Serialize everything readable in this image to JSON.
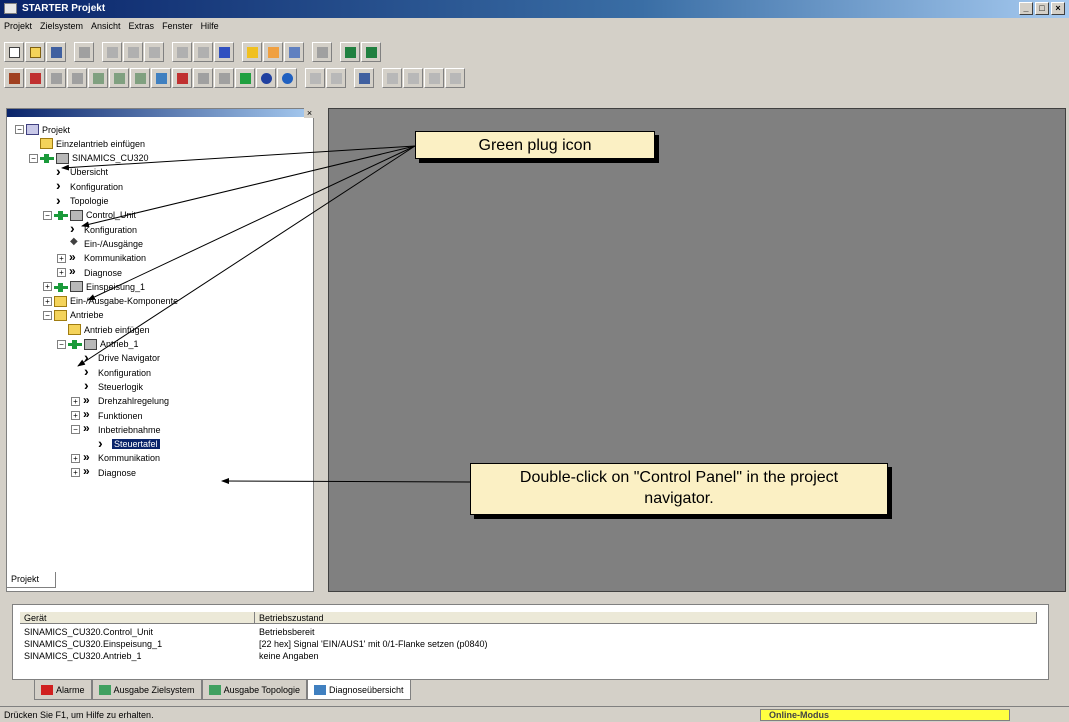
{
  "window": {
    "title": "STARTER  Projekt",
    "buttons": [
      "_",
      "□",
      "×"
    ]
  },
  "menu": [
    "Projekt",
    "Zielsystem",
    "Ansicht",
    "Extras",
    "Fenster",
    "Hilfe"
  ],
  "tree": {
    "tab": "Projekt",
    "nodes": [
      {
        "label": "Projekt",
        "indent": 0,
        "exp": "−",
        "icon": "proj"
      },
      {
        "label": "Einzelantrieb einfügen",
        "indent": 1,
        "icon": "folder"
      },
      {
        "label": "SINAMICS_CU320",
        "indent": 1,
        "exp": "−",
        "icon": "dev",
        "plug": true
      },
      {
        "label": "Übersicht",
        "indent": 2,
        "icon": "arrow"
      },
      {
        "label": "Konfiguration",
        "indent": 2,
        "icon": "arrow"
      },
      {
        "label": "Topologie",
        "indent": 2,
        "icon": "arrow"
      },
      {
        "label": "Control_Unit",
        "indent": 2,
        "exp": "−",
        "icon": "dev",
        "plug": true
      },
      {
        "label": "Konfiguration",
        "indent": 3,
        "icon": "arrow"
      },
      {
        "label": "Ein-/Ausgänge",
        "indent": 3,
        "icon": "io"
      },
      {
        "label": "Kommunikation",
        "indent": 3,
        "exp": "+",
        "icon": "darrow"
      },
      {
        "label": "Diagnose",
        "indent": 3,
        "exp": "+",
        "icon": "darrow"
      },
      {
        "label": "Einspeisung_1",
        "indent": 2,
        "exp": "+",
        "icon": "dev",
        "plug": true
      },
      {
        "label": "Ein-/Ausgabe-Komponente",
        "indent": 2,
        "exp": "+",
        "icon": "folder"
      },
      {
        "label": "Antriebe",
        "indent": 2,
        "exp": "−",
        "icon": "folder"
      },
      {
        "label": "Antrieb einfügen",
        "indent": 3,
        "icon": "folder"
      },
      {
        "label": "Antrieb_1",
        "indent": 3,
        "exp": "−",
        "icon": "dev",
        "plug": true
      },
      {
        "label": "Drive Navigator",
        "indent": 4,
        "icon": "arrow"
      },
      {
        "label": "Konfiguration",
        "indent": 4,
        "icon": "arrow"
      },
      {
        "label": "Steuerlogik",
        "indent": 4,
        "icon": "arrow"
      },
      {
        "label": "Drehzahlregelung",
        "indent": 4,
        "exp": "+",
        "icon": "darrow"
      },
      {
        "label": "Funktionen",
        "indent": 4,
        "exp": "+",
        "icon": "darrow"
      },
      {
        "label": "Inbetriebnahme",
        "indent": 4,
        "exp": "−",
        "icon": "darrow"
      },
      {
        "label": "Steuertafel",
        "indent": 5,
        "icon": "arrow",
        "selected": true
      },
      {
        "label": "Kommunikation",
        "indent": 4,
        "exp": "+",
        "icon": "darrow"
      },
      {
        "label": "Diagnose",
        "indent": 4,
        "exp": "+",
        "icon": "darrow"
      }
    ]
  },
  "callouts": {
    "plug": "Green plug icon",
    "control_panel": "Double-click on \"Control Panel\" in the project navigator."
  },
  "bottom": {
    "headers": [
      "Gerät",
      "Betriebszustand"
    ],
    "rows": [
      [
        "SINAMICS_CU320.Control_Unit",
        "Betriebsbereit"
      ],
      [
        "SINAMICS_CU320.Einspeisung_1",
        "[22 hex] Signal 'EIN/AUS1' mit 0/1-Flanke setzen (p0840)"
      ],
      [
        "SINAMICS_CU320.Antrieb_1",
        "keine Angaben"
      ]
    ],
    "tabs": [
      "Alarme",
      "Ausgabe Zielsystem",
      "Ausgabe Topologie",
      "Diagnoseübersicht"
    ]
  },
  "status": {
    "text": "Drücken Sie F1, um Hilfe zu erhalten.",
    "mode": "Online-Modus"
  }
}
